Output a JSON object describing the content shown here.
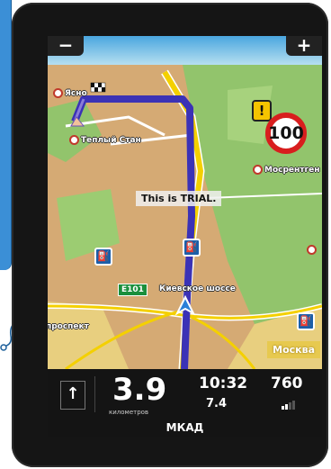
{
  "map": {
    "zoom_out": "−",
    "zoom_in": "+",
    "trial_text": "This is TRIAL.",
    "speed_limit": "100",
    "warning": "!",
    "road_number": "E101",
    "labels": {
      "place_top": "Ясно",
      "teply_stan": "Теплый Стан",
      "mosrentgen": "Мосрентген",
      "kievskoe": "Киевское шоссе",
      "prospekt": "проспект"
    },
    "city": "Москва",
    "fuel_icon": "fuel-station-icon"
  },
  "panel": {
    "turn_icon": "arrow-up-icon",
    "distance": "3.9",
    "distance_unit": "километров",
    "time": "10:32",
    "eta": "7.4",
    "altitude": "760",
    "street": "МКАД"
  },
  "colors": {
    "route": "#3b32b6",
    "road_yellow": "#f4d000",
    "grass": "#90c36a",
    "land": "#d5aa74",
    "sky": "#7ec2e8"
  }
}
